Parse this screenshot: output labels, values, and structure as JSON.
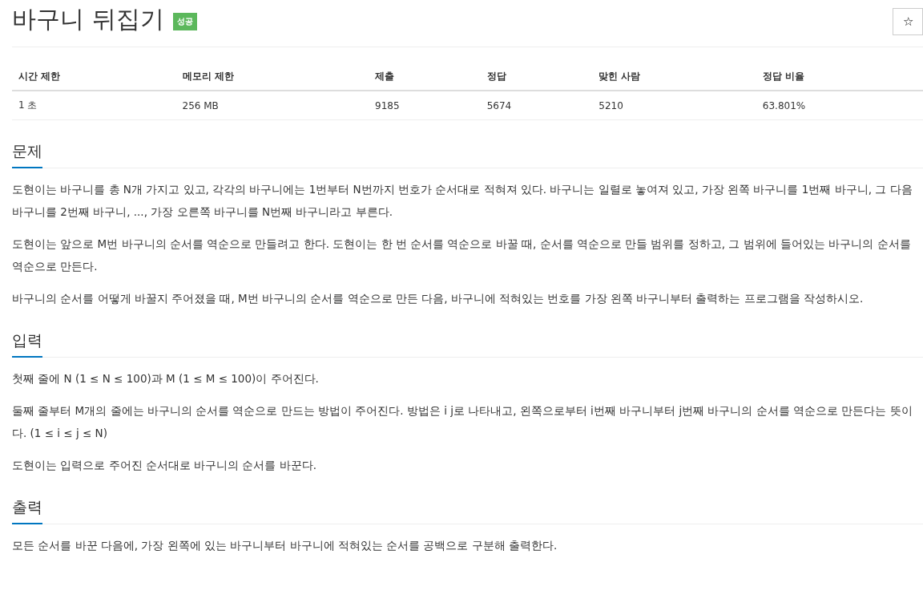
{
  "title": "바구니 뒤집기",
  "badge": {
    "label": "성공",
    "kind": "success"
  },
  "star_button": {
    "label": "☆"
  },
  "table": {
    "columns": [
      "시간 제한",
      "메모리 제한",
      "제출",
      "정답",
      "맞힌 사람",
      "정답 비율"
    ],
    "rows": [
      [
        "1 초",
        "256 MB",
        "9185",
        "5674",
        "5210",
        "63.801%"
      ]
    ]
  },
  "sections": [
    {
      "heading": "문제",
      "paragraphs": [
        "도현이는 바구니를 총 N개 가지고 있고, 각각의 바구니에는 1번부터 N번까지 번호가 순서대로 적혀져 있다. 바구니는 일렬로 놓여져 있고, 가장 왼쪽 바구니를 1번째 바구니, 그 다음 바구니를 2번째 바구니, ..., 가장 오른쪽 바구니를 N번째 바구니라고 부른다.",
        "도현이는 앞으로 M번 바구니의 순서를 역순으로 만들려고 한다. 도현이는 한 번 순서를 역순으로 바꿀 때, 순서를 역순으로 만들 범위를 정하고, 그 범위에 들어있는 바구니의 순서를 역순으로 만든다.",
        "바구니의 순서를 어떻게 바꿀지 주어졌을 때, M번 바구니의 순서를 역순으로 만든 다음, 바구니에 적혀있는 번호를 가장 왼쪽 바구니부터 출력하는 프로그램을 작성하시오."
      ]
    },
    {
      "heading": "입력",
      "paragraphs": [
        "첫째 줄에 N (1 ≤ N ≤ 100)과 M (1 ≤ M ≤ 100)이 주어진다.",
        "둘째 줄부터 M개의 줄에는 바구니의 순서를 역순으로 만드는 방법이 주어진다. 방법은 i j로 나타내고, 왼쪽으로부터 i번째 바구니부터 j번째 바구니의 순서를 역순으로 만든다는 뜻이다. (1 ≤ i ≤ j ≤ N)",
        "도현이는 입력으로 주어진 순서대로 바구니의 순서를 바꾼다."
      ]
    },
    {
      "heading": "출력",
      "paragraphs": [
        "모든 순서를 바꾼 다음에, 가장 왼쪽에 있는 바구니부터 바구니에 적혀있는 순서를 공백으로 구분해 출력한다."
      ]
    }
  ]
}
